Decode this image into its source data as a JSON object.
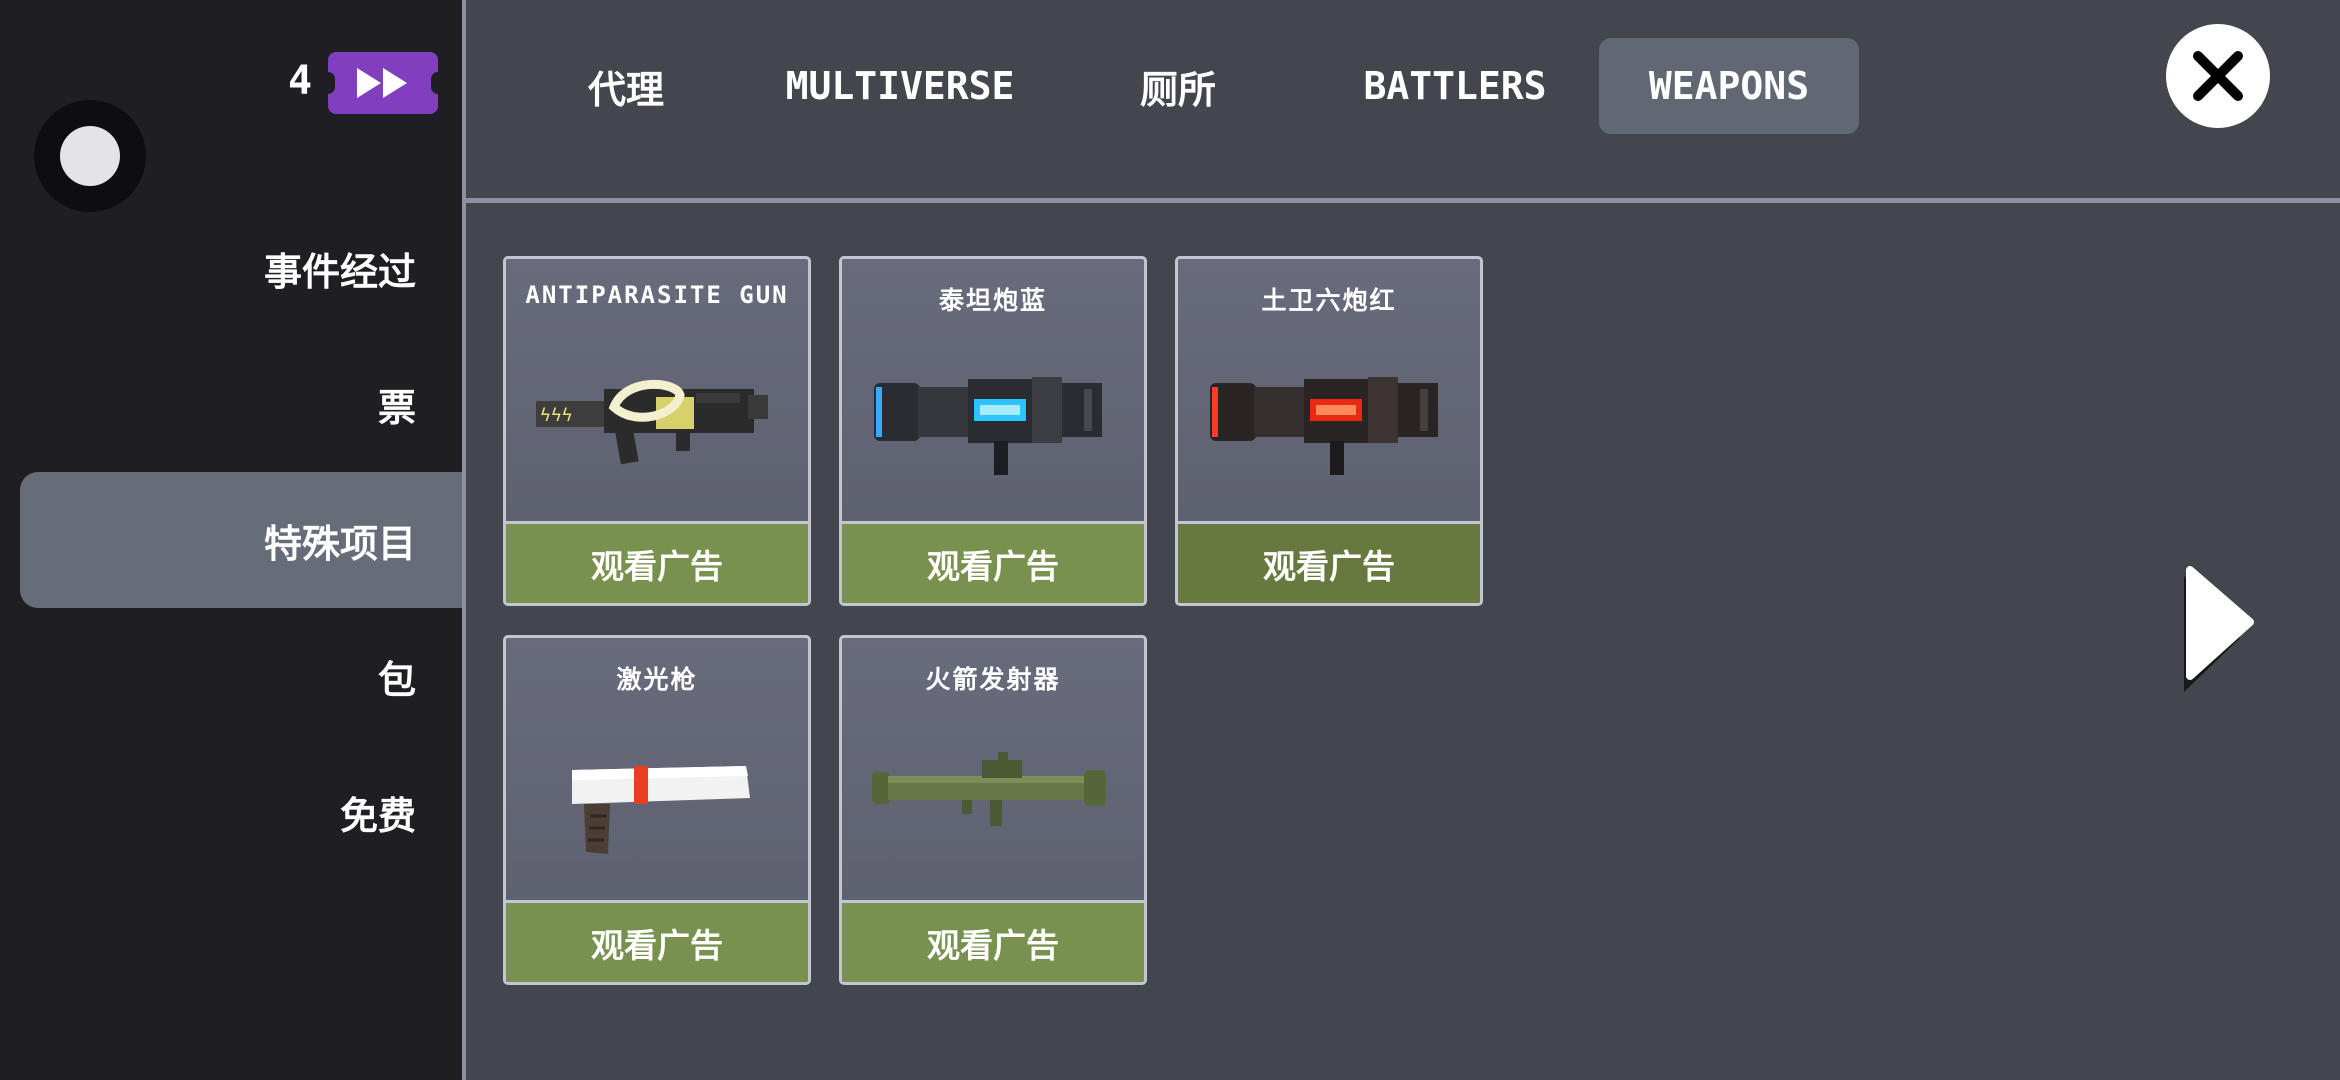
{
  "currency": {
    "ticket_count": "4"
  },
  "sidebar": {
    "items": [
      {
        "label": "事件经过",
        "active": false
      },
      {
        "label": "票",
        "active": false
      },
      {
        "label": "特殊项目",
        "active": true
      },
      {
        "label": "包",
        "active": false
      },
      {
        "label": "免费",
        "active": false
      }
    ]
  },
  "tabs": [
    {
      "label": "代理",
      "active": false
    },
    {
      "label": "MULTIVERSE",
      "active": false
    },
    {
      "label": "厕所",
      "active": false
    },
    {
      "label": "BATTLERS",
      "active": false
    },
    {
      "label": "WEAPONS",
      "active": true
    }
  ],
  "cards": [
    {
      "title": "ANTIPARASITE GUN",
      "button": "观看广告",
      "icon": "antiparasite-gun-icon"
    },
    {
      "title": "泰坦炮蓝",
      "button": "观看广告",
      "icon": "titan-cannon-blue-icon"
    },
    {
      "title": "土卫六炮红",
      "button": "观看广告",
      "icon": "titan-cannon-red-icon"
    },
    {
      "title": "激光枪",
      "button": "观看广告",
      "icon": "laser-gun-icon"
    },
    {
      "title": "火箭发射器",
      "button": "观看广告",
      "icon": "rocket-launcher-icon"
    }
  ],
  "colors": {
    "background": "#44464e",
    "sidebar": "#1f1f23",
    "accent_ticket": "#7f3fbf",
    "button_green": "#78914e",
    "active_tab": "#626873"
  }
}
